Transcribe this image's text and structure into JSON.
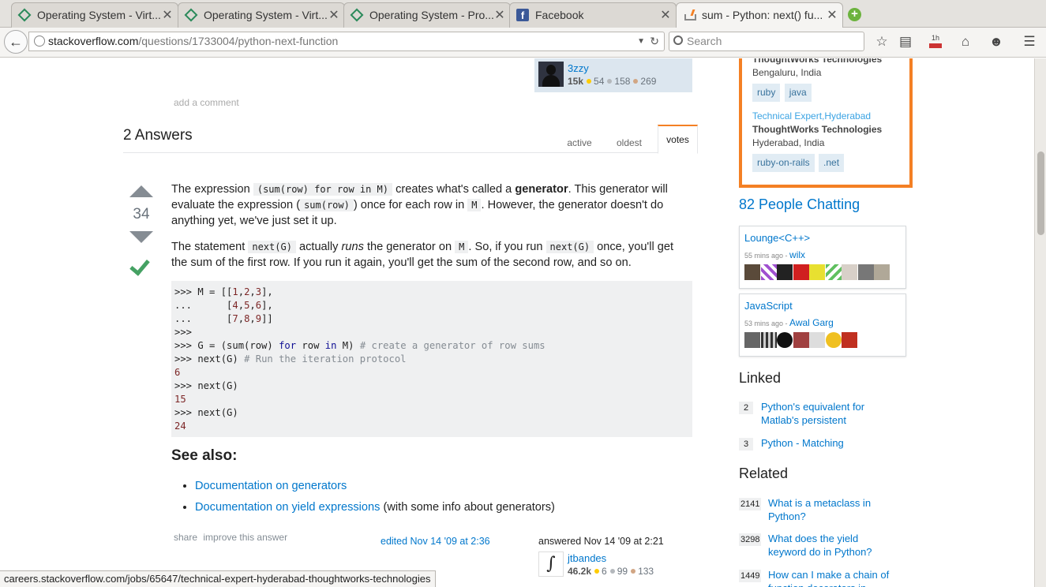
{
  "tabs": [
    {
      "label": "Operating System - Virt...",
      "icon": "diamond-icon"
    },
    {
      "label": "Operating System - Virt...",
      "icon": "diamond-icon"
    },
    {
      "label": "Operating System - Pro...",
      "icon": "diamond-icon"
    },
    {
      "label": "Facebook",
      "icon": "facebook-icon"
    },
    {
      "label": "sum - Python: next() fu...",
      "icon": "stackoverflow-icon"
    }
  ],
  "browser": {
    "url_domain": "stackoverflow.com",
    "url_path": "/questions/1733004/python-next-function",
    "search_placeholder": "Search",
    "badge_1h": "1h",
    "status_url": "careers.stackoverflow.com/jobs/65647/technical-expert-hyderabad-thoughtworks-technologies"
  },
  "question_user": {
    "name": "3zzy",
    "rep": "15k",
    "gold": "54",
    "silver": "158",
    "bronze": "269"
  },
  "add_comment": "add a comment",
  "answers": {
    "count_label": "2 Answers",
    "sort_tabs": [
      "active",
      "oldest",
      "votes"
    ],
    "active_sort": "votes"
  },
  "answer": {
    "votes": "34",
    "p1": {
      "t1": "The expression ",
      "c1": "(sum(row) for row in M)",
      "t2": " creates what's called a ",
      "b1": "generator",
      "t3": ". This generator will evaluate the expression (",
      "c2": "sum(row)",
      "t4": ") once for each row in ",
      "c3": "M",
      "t5": ". However, the generator doesn't do anything yet, we've just set it up."
    },
    "p2": {
      "t1": "The statement ",
      "c1": "next(G)",
      "t2": " actually ",
      "i1": "runs",
      "t3": " the generator on ",
      "c2": "M",
      "t4": ". So, if you run ",
      "c3": "next(G)",
      "t5": " once, you'll get the sum of the first row. If you run it again, you'll get the sum of the second row, and so on."
    },
    "code_lines": [
      ">>> M = [[1,2,3],",
      "...      [4,5,6],",
      "...      [7,8,9]]",
      ">>>",
      ">>> G = (sum(row) for row in M) # create a generator of row sums",
      ">>> next(G) # Run the iteration protocol",
      "6",
      ">>> next(G)",
      "15",
      ">>> next(G)",
      "24"
    ],
    "see_also": "See also:",
    "links": [
      {
        "text": "Documentation on generators",
        "suffix": ""
      },
      {
        "text": "Documentation on yield expressions",
        "suffix": " (with some info about generators)"
      }
    ],
    "menu": [
      "share",
      "improve this answer"
    ],
    "edited": "edited Nov 14 '09 at 2:36",
    "answered": "answered Nov 14 '09 at 2:21",
    "user": {
      "name": "jtbandes",
      "rep": "46.2k",
      "gold": "6",
      "silver": "99",
      "bronze": "133",
      "avatar_glyph": "∫"
    }
  },
  "sidebar": {
    "jobs": [
      {
        "title": "",
        "company": "ThoughtWorks Technologies",
        "location": "Bengaluru, India",
        "tags": [
          "ruby",
          "java"
        ]
      },
      {
        "title": "Technical Expert,Hyderabad",
        "company": "ThoughtWorks Technologies",
        "location": "Hyderabad, India",
        "tags": [
          "ruby-on-rails",
          ".net"
        ]
      }
    ],
    "chat_title": "82 People Chatting",
    "rooms": [
      {
        "name": "Lounge<C++>",
        "ago": "55 mins ago - ",
        "user": "wilx"
      },
      {
        "name": "JavaScript",
        "ago": "53 mins ago - ",
        "user": "Awal Garg"
      }
    ],
    "linked_title": "Linked",
    "linked": [
      {
        "count": "2",
        "title": "Python's equivalent for Matlab's persistent"
      },
      {
        "count": "3",
        "title": "Python - Matching"
      }
    ],
    "related_title": "Related",
    "related": [
      {
        "count": "2141",
        "title": "What is a metaclass in Python?"
      },
      {
        "count": "3298",
        "title": "What does the yield keyword do in Python?"
      },
      {
        "count": "1449",
        "title": "How can I make a chain of function decorators in"
      }
    ]
  },
  "colors": {
    "link": "#0077cc",
    "accent": "#f48024",
    "accepted": "#45a163"
  }
}
